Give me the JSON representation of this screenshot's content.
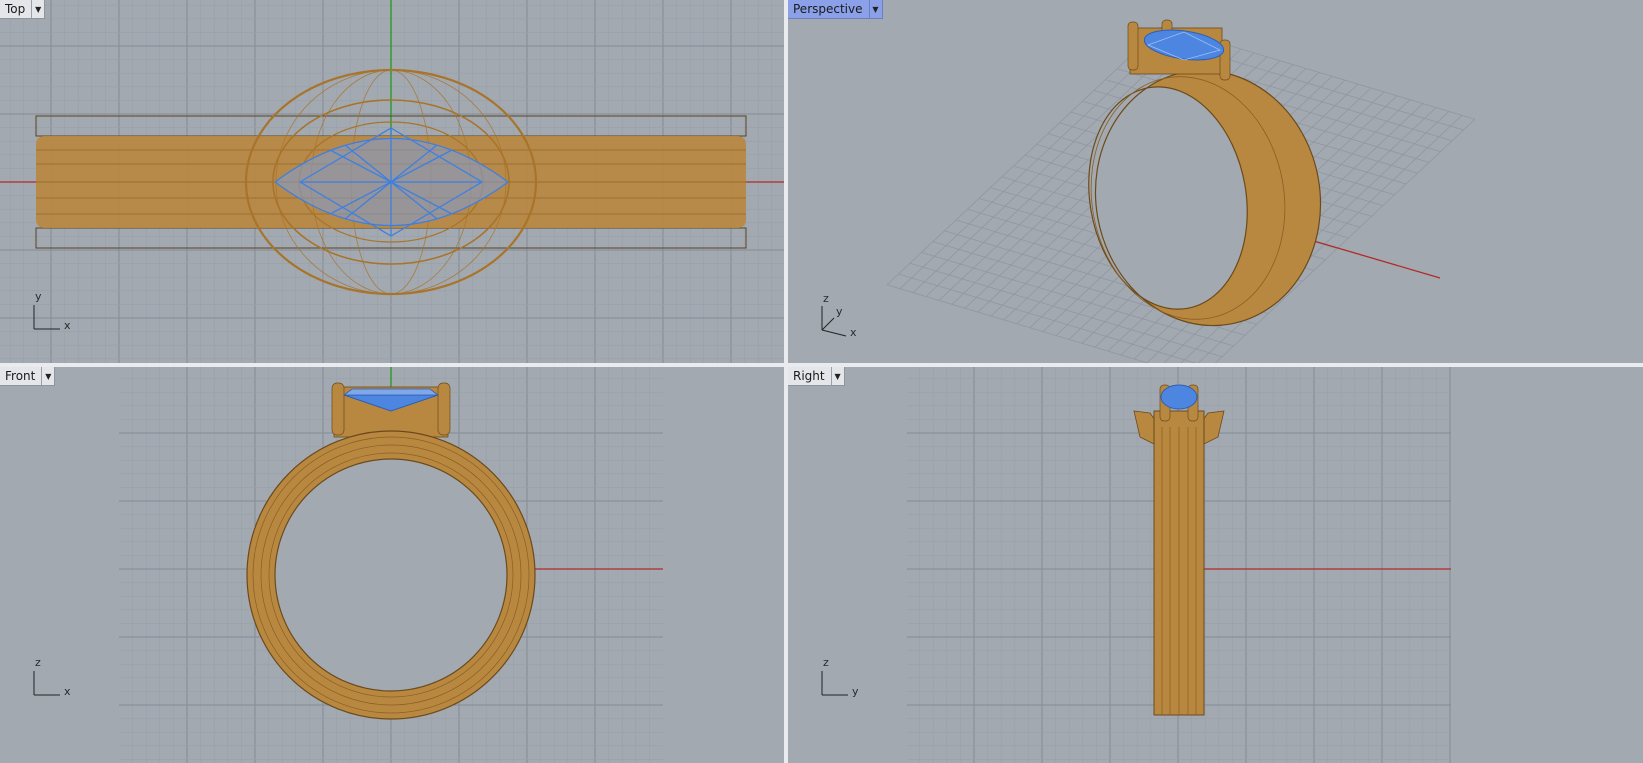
{
  "viewports": {
    "top": {
      "label": "Top",
      "axis_h": "x",
      "axis_v": "y"
    },
    "persp": {
      "label": "Perspective",
      "axis_h": "x",
      "axis_v": "y",
      "axis_z": "z"
    },
    "front": {
      "label": "Front",
      "axis_h": "x",
      "axis_v": "z"
    },
    "right": {
      "label": "Right",
      "axis_h": "y",
      "axis_v": "z"
    }
  },
  "icons": {
    "dropdown": "chevron-down-icon"
  },
  "colors": {
    "background": "#a3a9b1",
    "grid_minor": "#98a0a9",
    "grid_major": "#858c96",
    "x_axis": "#b22a2a",
    "y_axis": "#1f9a1f",
    "metal_wire": "#a8742a",
    "metal_fill": "#b98840",
    "gem_wire": "#3f7fe0",
    "active_tab": "#8aa0e8"
  }
}
